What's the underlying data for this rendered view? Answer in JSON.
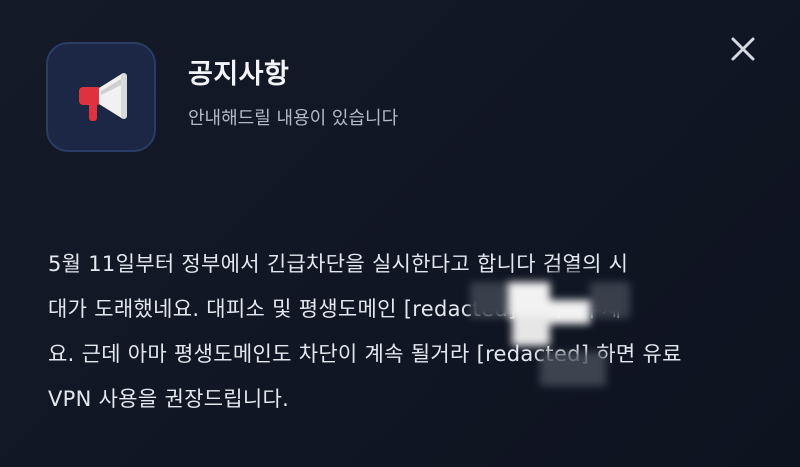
{
  "notice": {
    "title": "공지사항",
    "subtitle": "안내해드릴 내용이 있습니다",
    "body": "5월 11일부터 정부에서 긴급차단을 실시한다고 합니다 검열의 시\n대가 도래했네요. 대피소 및 평생도메인 [redacted] 기억해주세\n요. 근데 아마 평생도메인도 차단이 계속 될거라 [redacted] 하면 유료\nVPN 사용을 권장드립니다."
  },
  "icons": {
    "app": "megaphone-icon",
    "close": "close-icon"
  },
  "colors": {
    "background": "#111624",
    "icon_tile": "#1b2744",
    "megaphone_red": "#e0313f",
    "megaphone_white": "#f1f1f1"
  }
}
